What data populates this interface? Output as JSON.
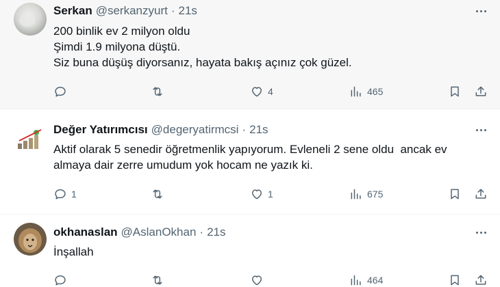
{
  "tweets": [
    {
      "name": "Serkan",
      "handle": "@serkanzyurt",
      "separator": "·",
      "time": "21s",
      "lines": [
        "200 binlik ev 2 milyon oldu",
        "Şimdi 1.9 milyona düştü.",
        "Siz buna düşüş diyorsanız, hayata bakış açınız çok güzel."
      ],
      "replies": "",
      "retweets": "",
      "likes": "4",
      "views": "465"
    },
    {
      "name": "Değer Yatırımcısı",
      "handle": "@degeryatirmcsi",
      "separator": "·",
      "time": "21s",
      "lines": [
        "Aktif olarak 5 senedir öğretmenlik yapıyorum. Evleneli 2 sene oldu  ancak ev",
        "almaya dair zerre umudum yok hocam ne yazık ki."
      ],
      "replies": "1",
      "retweets": "",
      "likes": "1",
      "views": "675"
    },
    {
      "name": "okhanaslan",
      "handle": "@AslanOkhan",
      "separator": "·",
      "time": "21s",
      "lines": [
        "İnşallah"
      ],
      "replies": "",
      "retweets": "",
      "likes": "",
      "views": "464"
    }
  ],
  "icons": {
    "reply": "reply-icon",
    "retweet": "retweet-icon",
    "like": "heart-icon",
    "views": "views-chart-icon",
    "bookmark": "bookmark-icon",
    "share": "share-icon",
    "more": "more-options-icon"
  },
  "colors": {
    "text": "#0f1419",
    "muted": "#536471",
    "highlight_background": "#f7f7f7",
    "divider": "#eff3f4"
  }
}
